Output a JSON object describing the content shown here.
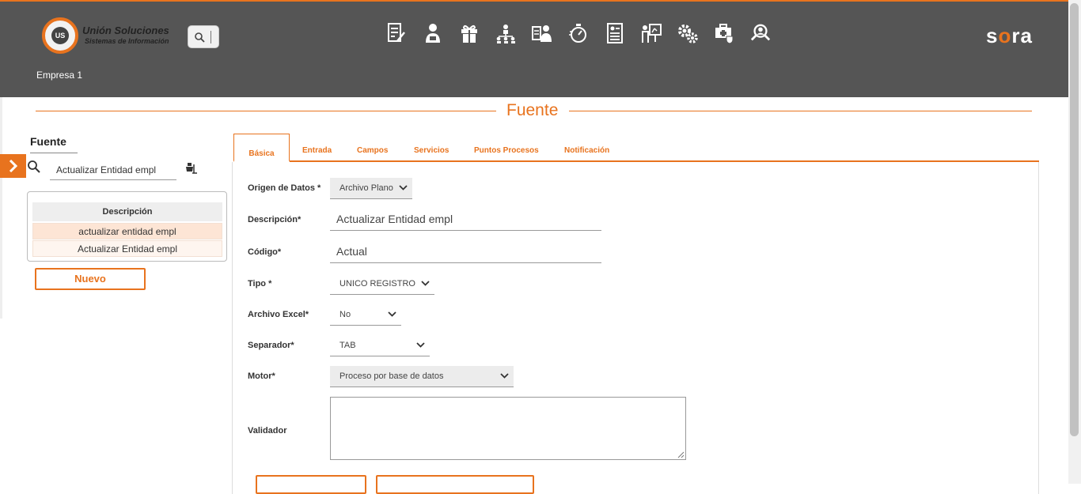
{
  "header": {
    "logo_badge": "UNION US",
    "logo_name": "Unión Soluciones",
    "logo_subtitle": "Sistemas de Información",
    "brand_prefix": "s",
    "brand_accent": "o",
    "brand_suffix": "ra",
    "company": "Empresa 1",
    "nav_icons": [
      "document-edit-icon",
      "user-badge-icon",
      "gift-icon",
      "org-chart-icon",
      "user-list-icon",
      "stopwatch-icon",
      "resume-icon",
      "presentation-icon",
      "gears-icon",
      "medical-kit-icon",
      "user-search-icon"
    ]
  },
  "page": {
    "title": "Fuente"
  },
  "left_panel": {
    "title": "Fuente",
    "search_value": "Actualizar Entidad empl",
    "table_header": "Descripción",
    "rows": [
      "actualizar entidad empl",
      "Actualizar Entidad empl"
    ],
    "new_button": "Nuevo"
  },
  "tabs": [
    "Básica",
    "Entrada",
    "Campos",
    "Servicios",
    "Puntos Procesos",
    "Notificación"
  ],
  "form": {
    "origen_label": "Origen de Datos *",
    "origen_value": "Archivo Plano",
    "descripcion_label": "Descripción*",
    "descripcion_value": "Actualizar Entidad empl",
    "codigo_label": "Código*",
    "codigo_value": "Actual",
    "tipo_label": "Tipo *",
    "tipo_value": "UNICO REGISTRO",
    "excel_label": "Archivo Excel*",
    "excel_value": "No",
    "separador_label": "Separador*",
    "separador_value": "TAB",
    "motor_label": "Motor*",
    "motor_value": "Proceso por base de datos",
    "validador_label": "Validador"
  },
  "colors": {
    "accent": "#e8731e",
    "header_bg": "#555555"
  }
}
